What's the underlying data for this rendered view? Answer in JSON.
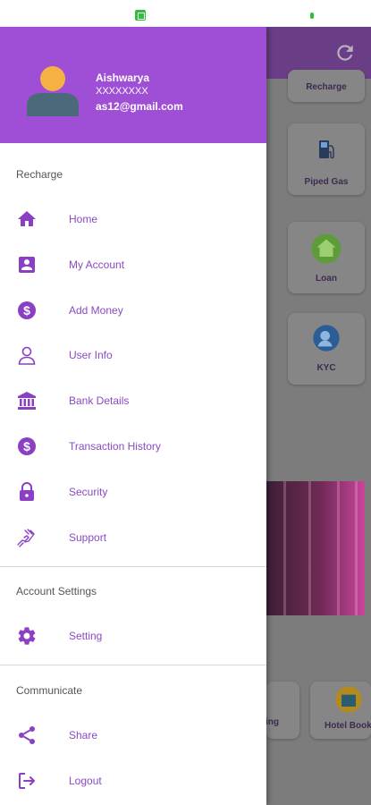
{
  "background": {
    "top_card_label": "Recharge",
    "cards": [
      {
        "label": "Piped Gas",
        "icon": "gas-pump-icon"
      },
      {
        "label": "Loan",
        "icon": "loan-house-icon"
      },
      {
        "label": "KYC",
        "icon": "kyc-icon"
      }
    ],
    "bottom_left_label": "ing",
    "bottom_right_label": "Hotel Booki"
  },
  "drawer": {
    "user": {
      "name": "Aishwarya",
      "phone": "XXXXXXXX",
      "email": "as12@gmail.com"
    },
    "sections": {
      "recharge": "Recharge",
      "account_settings": "Account Settings",
      "communicate": "Communicate"
    },
    "items": [
      {
        "label": "Home",
        "icon": "home-icon"
      },
      {
        "label": "My Account",
        "icon": "account-box-icon"
      },
      {
        "label": "Add Money",
        "icon": "dollar-circle-icon"
      },
      {
        "label": "User Info",
        "icon": "user-outline-icon"
      },
      {
        "label": "Bank Details",
        "icon": "bank-icon"
      },
      {
        "label": "Transaction History",
        "icon": "dollar-circle-icon"
      },
      {
        "label": "Security",
        "icon": "lock-icon"
      },
      {
        "label": "Support",
        "icon": "support-hands-icon"
      },
      {
        "label": "Setting",
        "icon": "gear-icon"
      },
      {
        "label": "Share",
        "icon": "share-icon"
      },
      {
        "label": "Logout",
        "icon": "logout-icon"
      }
    ]
  },
  "colors": {
    "accent": "#9f4fd6",
    "menu_text": "#8a4ac4",
    "icon": "#8a3fc4"
  }
}
